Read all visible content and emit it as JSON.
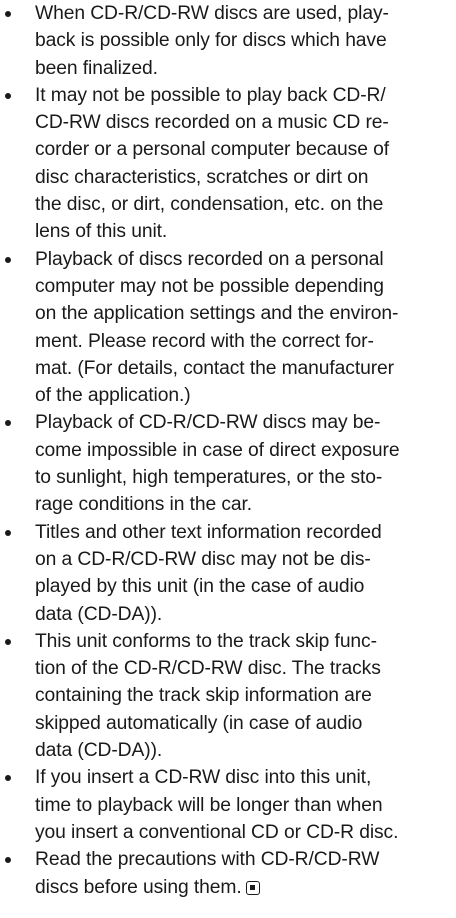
{
  "bullets": [
    {
      "text": "When CD-R/CD-RW discs are used, play-\nback is possible only for discs which have\nbeen finalized."
    },
    {
      "text": "It may not be possible to play back CD-R/\nCD-RW discs recorded on a music CD re-\ncorder or a personal computer because of\ndisc characteristics, scratches or dirt on\nthe disc, or dirt, condensation, etc. on the\nlens of this unit."
    },
    {
      "text": "Playback of discs recorded on a personal\ncomputer may not be possible depending\non the application settings and the environ-\nment. Please record with the correct for-\nmat. (For details, contact the manufacturer\nof the application.)"
    },
    {
      "text": "Playback of CD-R/CD-RW discs may be-\ncome impossible in case of direct exposure\nto sunlight, high temperatures, or the sto-\nrage conditions in the car."
    },
    {
      "text": "Titles and other text information recorded\non a CD-R/CD-RW disc may not be dis-\nplayed by this unit (in the case of audio\ndata (CD-DA))."
    },
    {
      "text": "This unit conforms to the track skip func-\ntion of the CD-R/CD-RW disc. The tracks\ncontaining the track skip information are\nskipped automatically (in case of audio\ndata (CD-DA))."
    },
    {
      "text": "If you insert a CD-RW disc into this unit,\ntime to playback will be longer than when\nyou insert a conventional CD or CD-R disc."
    },
    {
      "text": "Read the precautions with CD-R/CD-RW\ndiscs before using them."
    }
  ],
  "end_mark_icon": "end-of-section-mark-icon"
}
